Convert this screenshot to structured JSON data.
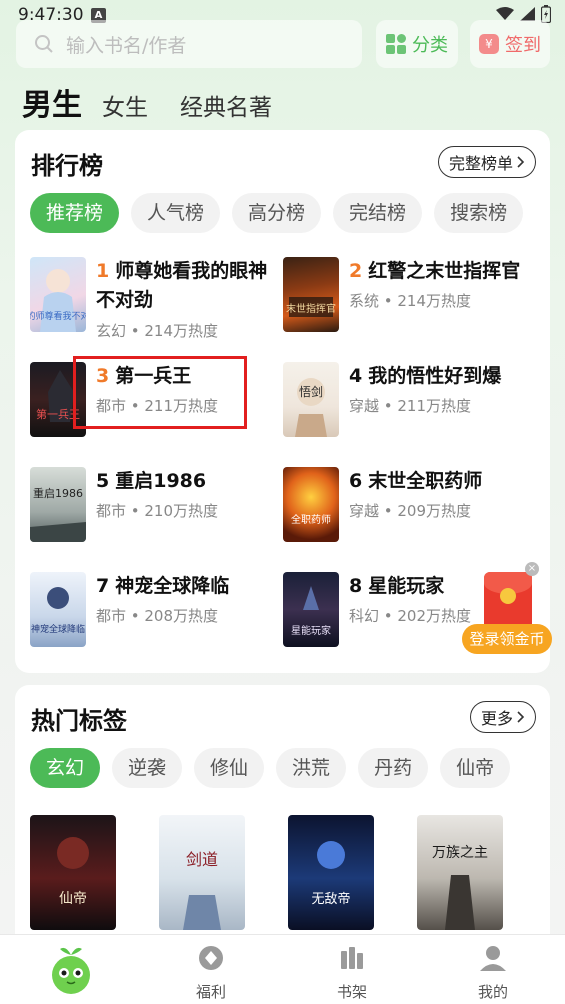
{
  "status": {
    "time": "9:47:30",
    "notif": "A"
  },
  "search": {
    "placeholder": "输入书名/作者"
  },
  "top_buttons": {
    "category": "分类",
    "signin": "签到",
    "signin_icon": "¥"
  },
  "gender_tabs": [
    "男生",
    "女生",
    "经典名著"
  ],
  "ranking": {
    "title": "排行榜",
    "more": "完整榜单",
    "tabs": [
      "推荐榜",
      "人气榜",
      "高分榜",
      "完结榜",
      "搜索榜"
    ],
    "books": [
      {
        "rank": "1",
        "title": "师尊她看我的眼神不对劲",
        "meta": "玄幻 • 214万热度",
        "cover_text": "我的师尊看我不对劲"
      },
      {
        "rank": "2",
        "title": "红警之末世指挥官",
        "meta": "系统 • 214万热度",
        "cover_text": "末世指挥官"
      },
      {
        "rank": "3",
        "title": "第一兵王",
        "meta": "都市 • 211万热度",
        "cover_text": "第一兵王"
      },
      {
        "rank": "4",
        "title": "我的悟性好到爆",
        "meta": "穿越 • 211万热度",
        "cover_text": "悟剑"
      },
      {
        "rank": "5",
        "title": "重启1986",
        "meta": "都市 • 210万热度",
        "cover_text": "重启1986"
      },
      {
        "rank": "6",
        "title": "末世全职药师",
        "meta": "穿越 • 209万热度",
        "cover_text": "全职药师"
      },
      {
        "rank": "7",
        "title": "神宠全球降临",
        "meta": "都市 • 208万热度",
        "cover_text": "神宠全球降临"
      },
      {
        "rank": "8",
        "title": "星能玩家",
        "meta": "科幻 • 202万热度",
        "cover_text": "星能玩家"
      }
    ]
  },
  "redpacket": {
    "label": "登录领金币",
    "close": "×"
  },
  "tags": {
    "title": "热门标签",
    "more": "更多",
    "items": [
      "玄幻",
      "逆袭",
      "修仙",
      "洪荒",
      "丹药",
      "仙帝"
    ],
    "covers": [
      "仙帝",
      "剑道",
      "无敌帝",
      "万族之主"
    ]
  },
  "bottom_nav": [
    "福利",
    "书架",
    "我的"
  ],
  "colors": {
    "accent": "#4cba57",
    "rank_top": "#f07a2a",
    "highlight": "#e21f1f"
  }
}
